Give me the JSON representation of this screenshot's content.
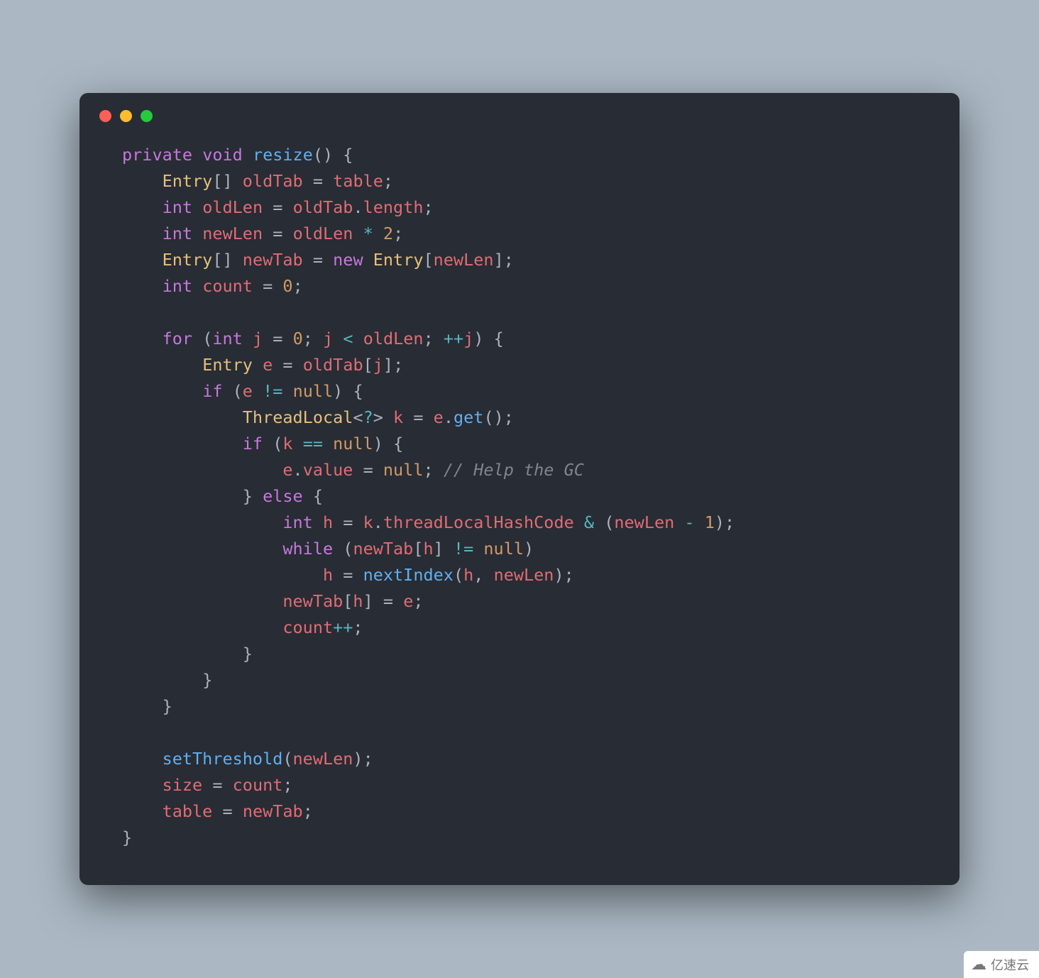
{
  "watermark": {
    "text": "亿速云"
  },
  "code": {
    "tokens": [
      [
        [
          "kw",
          "private"
        ],
        [
          "def",
          " "
        ],
        [
          "typeI",
          "void"
        ],
        [
          "def",
          " "
        ],
        [
          "fn",
          "resize"
        ],
        [
          "pun",
          "()"
        ],
        [
          "def",
          " "
        ],
        [
          "pun",
          "{"
        ]
      ],
      [
        [
          "def",
          "    "
        ],
        [
          "type",
          "Entry"
        ],
        [
          "pun",
          "[]"
        ],
        [
          "def",
          " "
        ],
        [
          "var",
          "oldTab"
        ],
        [
          "def",
          " "
        ],
        [
          "eq",
          "="
        ],
        [
          "def",
          " "
        ],
        [
          "var",
          "table"
        ],
        [
          "pun",
          ";"
        ]
      ],
      [
        [
          "def",
          "    "
        ],
        [
          "typeI",
          "int"
        ],
        [
          "def",
          " "
        ],
        [
          "var",
          "oldLen"
        ],
        [
          "def",
          " "
        ],
        [
          "eq",
          "="
        ],
        [
          "def",
          " "
        ],
        [
          "var",
          "oldTab"
        ],
        [
          "pun",
          "."
        ],
        [
          "var",
          "length"
        ],
        [
          "pun",
          ";"
        ]
      ],
      [
        [
          "def",
          "    "
        ],
        [
          "typeI",
          "int"
        ],
        [
          "def",
          " "
        ],
        [
          "var",
          "newLen"
        ],
        [
          "def",
          " "
        ],
        [
          "eq",
          "="
        ],
        [
          "def",
          " "
        ],
        [
          "var",
          "oldLen"
        ],
        [
          "def",
          " "
        ],
        [
          "op",
          "*"
        ],
        [
          "def",
          " "
        ],
        [
          "num",
          "2"
        ],
        [
          "pun",
          ";"
        ]
      ],
      [
        [
          "def",
          "    "
        ],
        [
          "type",
          "Entry"
        ],
        [
          "pun",
          "[]"
        ],
        [
          "def",
          " "
        ],
        [
          "var",
          "newTab"
        ],
        [
          "def",
          " "
        ],
        [
          "eq",
          "="
        ],
        [
          "def",
          " "
        ],
        [
          "kw",
          "new"
        ],
        [
          "def",
          " "
        ],
        [
          "type",
          "Entry"
        ],
        [
          "pun",
          "["
        ],
        [
          "var",
          "newLen"
        ],
        [
          "pun",
          "];"
        ]
      ],
      [
        [
          "def",
          "    "
        ],
        [
          "typeI",
          "int"
        ],
        [
          "def",
          " "
        ],
        [
          "var",
          "count"
        ],
        [
          "def",
          " "
        ],
        [
          "eq",
          "="
        ],
        [
          "def",
          " "
        ],
        [
          "num",
          "0"
        ],
        [
          "pun",
          ";"
        ]
      ],
      [
        [
          "def",
          ""
        ]
      ],
      [
        [
          "def",
          "    "
        ],
        [
          "kw",
          "for"
        ],
        [
          "def",
          " "
        ],
        [
          "pun",
          "("
        ],
        [
          "typeI",
          "int"
        ],
        [
          "def",
          " "
        ],
        [
          "var",
          "j"
        ],
        [
          "def",
          " "
        ],
        [
          "eq",
          "="
        ],
        [
          "def",
          " "
        ],
        [
          "num",
          "0"
        ],
        [
          "pun",
          ";"
        ],
        [
          "def",
          " "
        ],
        [
          "var",
          "j"
        ],
        [
          "def",
          " "
        ],
        [
          "op",
          "<"
        ],
        [
          "def",
          " "
        ],
        [
          "var",
          "oldLen"
        ],
        [
          "pun",
          ";"
        ],
        [
          "def",
          " "
        ],
        [
          "op",
          "++"
        ],
        [
          "var",
          "j"
        ],
        [
          "pun",
          ")"
        ],
        [
          "def",
          " "
        ],
        [
          "pun",
          "{"
        ]
      ],
      [
        [
          "def",
          "        "
        ],
        [
          "type",
          "Entry"
        ],
        [
          "def",
          " "
        ],
        [
          "var",
          "e"
        ],
        [
          "def",
          " "
        ],
        [
          "eq",
          "="
        ],
        [
          "def",
          " "
        ],
        [
          "var",
          "oldTab"
        ],
        [
          "pun",
          "["
        ],
        [
          "var",
          "j"
        ],
        [
          "pun",
          "];"
        ]
      ],
      [
        [
          "def",
          "        "
        ],
        [
          "kw",
          "if"
        ],
        [
          "def",
          " "
        ],
        [
          "pun",
          "("
        ],
        [
          "var",
          "e"
        ],
        [
          "def",
          " "
        ],
        [
          "op",
          "!="
        ],
        [
          "def",
          " "
        ],
        [
          "cnst",
          "null"
        ],
        [
          "pun",
          ")"
        ],
        [
          "def",
          " "
        ],
        [
          "pun",
          "{"
        ]
      ],
      [
        [
          "def",
          "            "
        ],
        [
          "type",
          "ThreadLocal"
        ],
        [
          "pun",
          "<"
        ],
        [
          "op",
          "?"
        ],
        [
          "pun",
          ">"
        ],
        [
          "def",
          " "
        ],
        [
          "var",
          "k"
        ],
        [
          "def",
          " "
        ],
        [
          "eq",
          "="
        ],
        [
          "def",
          " "
        ],
        [
          "var",
          "e"
        ],
        [
          "pun",
          "."
        ],
        [
          "fn",
          "get"
        ],
        [
          "pun",
          "();"
        ]
      ],
      [
        [
          "def",
          "            "
        ],
        [
          "kw",
          "if"
        ],
        [
          "def",
          " "
        ],
        [
          "pun",
          "("
        ],
        [
          "var",
          "k"
        ],
        [
          "def",
          " "
        ],
        [
          "op",
          "=="
        ],
        [
          "def",
          " "
        ],
        [
          "cnst",
          "null"
        ],
        [
          "pun",
          ")"
        ],
        [
          "def",
          " "
        ],
        [
          "pun",
          "{"
        ]
      ],
      [
        [
          "def",
          "                "
        ],
        [
          "var",
          "e"
        ],
        [
          "pun",
          "."
        ],
        [
          "prop",
          "value"
        ],
        [
          "def",
          " "
        ],
        [
          "eq",
          "="
        ],
        [
          "def",
          " "
        ],
        [
          "cnst",
          "null"
        ],
        [
          "pun",
          ";"
        ],
        [
          "def",
          " "
        ],
        [
          "cmt",
          "// Help the GC"
        ]
      ],
      [
        [
          "def",
          "            "
        ],
        [
          "pun",
          "}"
        ],
        [
          "def",
          " "
        ],
        [
          "kw",
          "else"
        ],
        [
          "def",
          " "
        ],
        [
          "pun",
          "{"
        ]
      ],
      [
        [
          "def",
          "                "
        ],
        [
          "typeI",
          "int"
        ],
        [
          "def",
          " "
        ],
        [
          "var",
          "h"
        ],
        [
          "def",
          " "
        ],
        [
          "eq",
          "="
        ],
        [
          "def",
          " "
        ],
        [
          "var",
          "k"
        ],
        [
          "pun",
          "."
        ],
        [
          "var",
          "threadLocalHashCode"
        ],
        [
          "def",
          " "
        ],
        [
          "op",
          "&"
        ],
        [
          "def",
          " "
        ],
        [
          "pun",
          "("
        ],
        [
          "var",
          "newLen"
        ],
        [
          "def",
          " "
        ],
        [
          "op",
          "-"
        ],
        [
          "def",
          " "
        ],
        [
          "num",
          "1"
        ],
        [
          "pun",
          ");"
        ]
      ],
      [
        [
          "def",
          "                "
        ],
        [
          "kw",
          "while"
        ],
        [
          "def",
          " "
        ],
        [
          "pun",
          "("
        ],
        [
          "var",
          "newTab"
        ],
        [
          "pun",
          "["
        ],
        [
          "var",
          "h"
        ],
        [
          "pun",
          "]"
        ],
        [
          "def",
          " "
        ],
        [
          "op",
          "!="
        ],
        [
          "def",
          " "
        ],
        [
          "cnst",
          "null"
        ],
        [
          "pun",
          ")"
        ]
      ],
      [
        [
          "def",
          "                    "
        ],
        [
          "var",
          "h"
        ],
        [
          "def",
          " "
        ],
        [
          "eq",
          "="
        ],
        [
          "def",
          " "
        ],
        [
          "fn",
          "nextIndex"
        ],
        [
          "pun",
          "("
        ],
        [
          "var",
          "h"
        ],
        [
          "pun",
          ","
        ],
        [
          "def",
          " "
        ],
        [
          "var",
          "newLen"
        ],
        [
          "pun",
          ");"
        ]
      ],
      [
        [
          "def",
          "                "
        ],
        [
          "var",
          "newTab"
        ],
        [
          "pun",
          "["
        ],
        [
          "var",
          "h"
        ],
        [
          "pun",
          "]"
        ],
        [
          "def",
          " "
        ],
        [
          "eq",
          "="
        ],
        [
          "def",
          " "
        ],
        [
          "var",
          "e"
        ],
        [
          "pun",
          ";"
        ]
      ],
      [
        [
          "def",
          "                "
        ],
        [
          "var",
          "count"
        ],
        [
          "op",
          "++"
        ],
        [
          "pun",
          ";"
        ]
      ],
      [
        [
          "def",
          "            "
        ],
        [
          "pun",
          "}"
        ]
      ],
      [
        [
          "def",
          "        "
        ],
        [
          "pun",
          "}"
        ]
      ],
      [
        [
          "def",
          "    "
        ],
        [
          "pun",
          "}"
        ]
      ],
      [
        [
          "def",
          ""
        ]
      ],
      [
        [
          "def",
          "    "
        ],
        [
          "fn",
          "setThreshold"
        ],
        [
          "pun",
          "("
        ],
        [
          "var",
          "newLen"
        ],
        [
          "pun",
          ");"
        ]
      ],
      [
        [
          "def",
          "    "
        ],
        [
          "var",
          "size"
        ],
        [
          "def",
          " "
        ],
        [
          "eq",
          "="
        ],
        [
          "def",
          " "
        ],
        [
          "var",
          "count"
        ],
        [
          "pun",
          ";"
        ]
      ],
      [
        [
          "def",
          "    "
        ],
        [
          "var",
          "table"
        ],
        [
          "def",
          " "
        ],
        [
          "eq",
          "="
        ],
        [
          "def",
          " "
        ],
        [
          "var",
          "newTab"
        ],
        [
          "pun",
          ";"
        ]
      ],
      [
        [
          "pun",
          "}"
        ]
      ]
    ]
  }
}
